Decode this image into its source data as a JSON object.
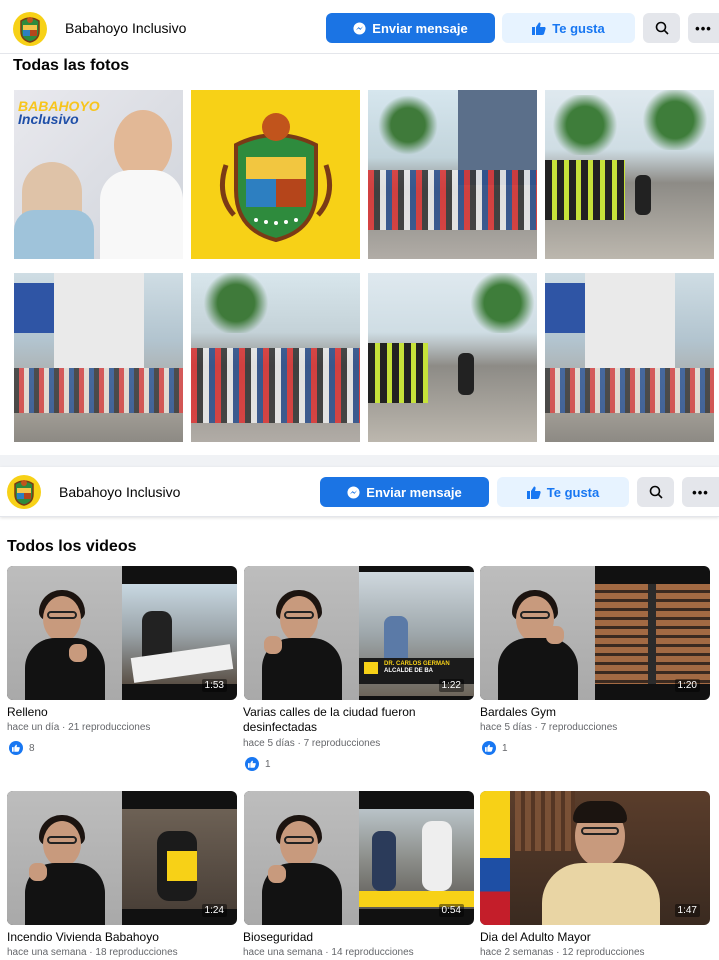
{
  "header": {
    "page_name": "Babahoyo Inclusivo",
    "message_label": "Enviar mensaje",
    "like_label": "Te gusta",
    "search_icon": "search-icon",
    "more_icon": "more-icon",
    "messenger_icon": "messenger-icon",
    "thumbs_up_icon": "thumbs-up-icon"
  },
  "photos": {
    "title": "Todas las fotos",
    "items": [
      {
        "kind": "banner",
        "banner_line1": "BABAHOYO",
        "banner_line2": "Inclusivo"
      },
      {
        "kind": "logo"
      },
      {
        "kind": "street"
      },
      {
        "kind": "street"
      },
      {
        "kind": "street"
      },
      {
        "kind": "street"
      },
      {
        "kind": "street"
      },
      {
        "kind": "street"
      }
    ]
  },
  "videos": {
    "title": "Todos los videos",
    "items": [
      {
        "title": "Relleno",
        "meta": "hace un día · 21 reproducciones",
        "likes": "8",
        "duration": "1:53"
      },
      {
        "title": "Varias calles de la ciudad fueron desinfectadas",
        "meta": "hace 5 días · 7 reproducciones",
        "likes": "1",
        "duration": "1:22",
        "overlay_line1": "DR. CARLOS GERMAN",
        "overlay_line2": "ALCALDE DE BA"
      },
      {
        "title": "Bardales Gym",
        "meta": "hace 5 días · 7 reproducciones",
        "likes": "1",
        "duration": "1:20"
      },
      {
        "title": "Incendio Vivienda Babahoyo",
        "meta": "hace una semana · 18 reproducciones",
        "duration": "1:24"
      },
      {
        "title": "Bioseguridad",
        "meta": "hace una semana · 14 reproducciones",
        "duration": "0:54"
      },
      {
        "title": "Dia del Adulto Mayor",
        "meta": "hace 2 semanas · 12 reproducciones",
        "duration": "1:47"
      }
    ]
  },
  "colors": {
    "primary": "#1b74e4",
    "like_bg": "#e7f3ff",
    "like_text": "#1877f2",
    "logo_yellow": "#f7d117"
  }
}
